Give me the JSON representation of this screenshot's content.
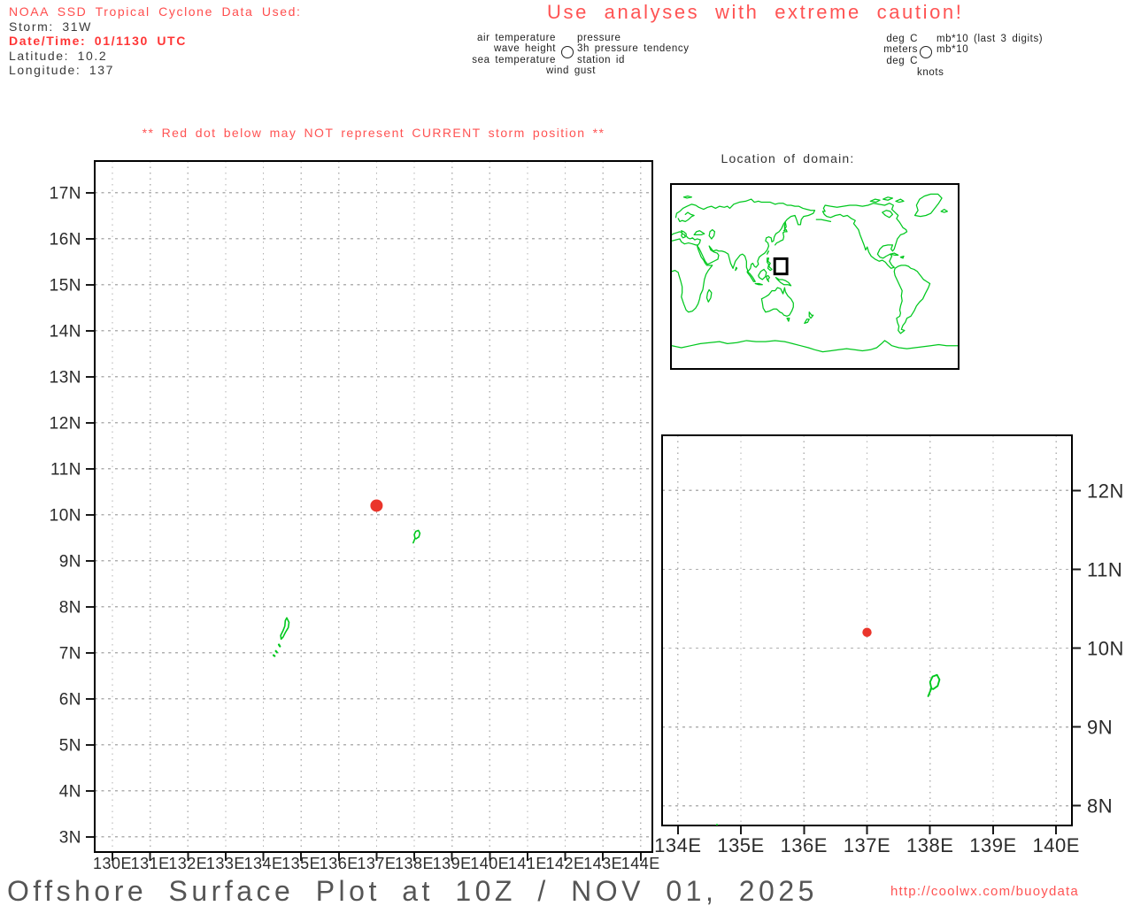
{
  "header": {
    "source_line": "NOAA SSD Tropical Cyclone Data Used:",
    "storm": "Storm: 31W",
    "datetime": "Date/Time: 01/1130 UTC",
    "latitude": "Latitude: 10.2",
    "longitude": "Longitude: 137"
  },
  "caution": "Use analyses with extreme caution!",
  "legend": {
    "variables": {
      "left": [
        "air temperature",
        "wave height",
        "sea temperature"
      ],
      "right": [
        "pressure",
        "3h pressure tendency",
        "station id"
      ],
      "bottom": "wind gust"
    },
    "units": {
      "left": [
        "deg C",
        "meters",
        "deg C"
      ],
      "right": [
        "mb*10 (last 3 digits)",
        "mb*10"
      ],
      "bottom": "knots"
    }
  },
  "warning": "** Red dot below may NOT represent CURRENT storm position **",
  "world_map": {
    "title": "Location of domain:",
    "domain_rect": {
      "lon_min": 129.5,
      "lon_max": 145,
      "lat_min": 2.5,
      "lat_max": 17.5
    }
  },
  "chart_data": [
    {
      "type": "scatter",
      "name": "main-domain-map",
      "x_tick_values": [
        130,
        131,
        132,
        133,
        134,
        135,
        136,
        137,
        138,
        139,
        140,
        141,
        142,
        143,
        144
      ],
      "x_tick_labels": [
        "130E",
        "131E",
        "132E",
        "133E",
        "134E",
        "135E",
        "136E",
        "137E",
        "138E",
        "139E",
        "140E",
        "141E",
        "142E",
        "143E",
        "144E"
      ],
      "y_tick_values": [
        3,
        4,
        5,
        6,
        7,
        8,
        9,
        10,
        11,
        12,
        13,
        14,
        15,
        16,
        17
      ],
      "y_tick_labels": [
        "3N",
        "4N",
        "5N",
        "6N",
        "7N",
        "8N",
        "9N",
        "10N",
        "11N",
        "12N",
        "13N",
        "14N",
        "15N",
        "16N",
        "17N"
      ],
      "xlim": [
        129.53,
        144.31
      ],
      "ylim": [
        2.67,
        17.69
      ],
      "grid": true,
      "points": [
        {
          "lon": 137,
          "lat": 10.2,
          "name": "storm-position"
        }
      ],
      "features": [
        "Yap island coastline",
        "Palau islands coastline"
      ]
    },
    {
      "type": "scatter",
      "name": "zoom-domain-map",
      "x_tick_values": [
        134,
        135,
        136,
        137,
        138,
        139,
        140
      ],
      "x_tick_labels": [
        "134E",
        "135E",
        "136E",
        "137E",
        "138E",
        "139E",
        "140E"
      ],
      "y_tick_values": [
        8,
        9,
        10,
        11,
        12
      ],
      "y_tick_labels": [
        "8N",
        "9N",
        "10N",
        "11N",
        "12N"
      ],
      "xlim": [
        133.75,
        140.25
      ],
      "ylim": [
        7.75,
        12.7
      ],
      "grid": true,
      "points": [
        {
          "lon": 137,
          "lat": 10.2,
          "name": "storm-position"
        }
      ],
      "features": [
        "Yap island coastline",
        "Palau islands coastline"
      ]
    }
  ],
  "footer": {
    "title": "Offshore Surface Plot at 10Z / NOV 01, 2025",
    "url": "http://coolwx.com/buoydata"
  },
  "colors": {
    "red_text": "#ff5353",
    "storm_dot": "#ea352b",
    "coastline": "#00c81e",
    "grid": "#b0b0b0",
    "axis_text": "#2b2b2b",
    "tick": "#1a1a1a",
    "border": "#000000",
    "title_text": "#555555"
  }
}
